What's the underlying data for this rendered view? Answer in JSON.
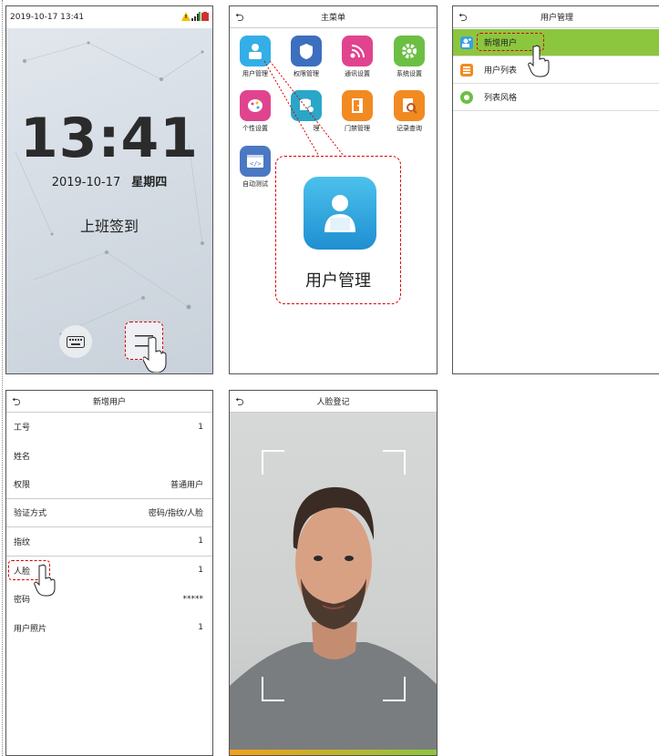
{
  "panel1": {
    "status_datetime": "2019-10-17 13:41",
    "clock": "13:41",
    "date": "2019-10-17",
    "weekday": "星期四",
    "checkin_label": "上班签到",
    "icons": [
      "warning-icon",
      "signal-icon",
      "battery-icon",
      "keyboard-icon",
      "menu-icon",
      "hand-pointer-icon"
    ]
  },
  "panel2": {
    "title": "主菜单",
    "apps": [
      {
        "label": "用户管理",
        "icon": "user-management-icon",
        "color": "#34aee6"
      },
      {
        "label": "权限管理",
        "icon": "permission-icon",
        "color": "#3c6fbf"
      },
      {
        "label": "通讯设置",
        "icon": "communication-icon",
        "color": "#e0448f"
      },
      {
        "label": "系统设置",
        "icon": "gear-icon",
        "color": "#6cbf43"
      },
      {
        "label": "个性设置",
        "icon": "palette-icon",
        "color": "#e0448f"
      },
      {
        "label": "理",
        "icon": "data-management-icon",
        "color": "#2aa6c9"
      },
      {
        "label": "门禁管理",
        "icon": "door-icon",
        "color": "#f28a22"
      },
      {
        "label": "记录查询",
        "icon": "record-search-icon",
        "color": "#f28a22"
      },
      {
        "label": "自动测试",
        "icon": "auto-test-icon",
        "color": "#4a78c2"
      }
    ],
    "zoom_label": "用户管理"
  },
  "panel3": {
    "title": "用户管理",
    "items": [
      {
        "label": "新增用户",
        "icon": "add-user-icon",
        "color": "#3aa0e0"
      },
      {
        "label": "用户列表",
        "icon": "user-list-icon",
        "color": "#f28a22"
      },
      {
        "label": "列表风格",
        "icon": "list-style-icon",
        "color": "#6cbf43"
      }
    ]
  },
  "panel4": {
    "title": "新增用户",
    "rows": [
      {
        "label": "工号",
        "value": "1"
      },
      {
        "label": "姓名",
        "value": ""
      },
      {
        "label": "权限",
        "value": "普通用户"
      },
      {
        "label": "验证方式",
        "value": "密码/指纹/人脸"
      },
      {
        "label": "指纹",
        "value": "1"
      },
      {
        "label": "人脸",
        "value": "1"
      },
      {
        "label": "密码",
        "value": "*****"
      },
      {
        "label": "用户照片",
        "value": "1"
      }
    ]
  },
  "panel5": {
    "title": "人脸登记",
    "progress": 1.0
  }
}
